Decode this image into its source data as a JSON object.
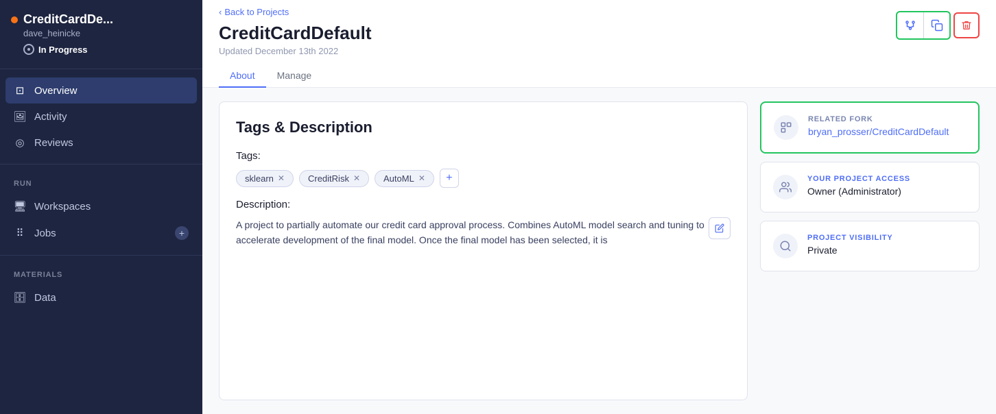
{
  "sidebar": {
    "project_name": "CreditCardDe...",
    "user": "dave_heinicke",
    "status": "In Progress",
    "nav_items": [
      {
        "id": "overview",
        "label": "Overview",
        "active": true
      },
      {
        "id": "activity",
        "label": "Activity",
        "active": false
      },
      {
        "id": "reviews",
        "label": "Reviews",
        "active": false
      }
    ],
    "run_section": "RUN",
    "run_items": [
      {
        "id": "workspaces",
        "label": "Workspaces"
      },
      {
        "id": "jobs",
        "label": "Jobs",
        "badge": "+"
      }
    ],
    "materials_section": "MATERIALS",
    "materials_items": [
      {
        "id": "data",
        "label": "Data"
      }
    ]
  },
  "header": {
    "back_label": "Back to Projects",
    "project_title": "CreditCardDefault",
    "updated_text": "Updated December 13th 2022"
  },
  "tabs": [
    {
      "id": "about",
      "label": "About",
      "active": true
    },
    {
      "id": "manage",
      "label": "Manage",
      "active": false
    }
  ],
  "main_panel": {
    "title": "Tags & Description",
    "tags_label": "Tags:",
    "tags": [
      {
        "label": "sklearn"
      },
      {
        "label": "CreditRisk"
      },
      {
        "label": "AutoML"
      }
    ],
    "description_label": "Description:",
    "description_text": "A project to partially automate our credit card approval process. Combines AutoML model search and tuning to accelerate development of the final model. Once the final model has been selected, it is"
  },
  "right_panel": {
    "related_fork": {
      "label": "RELATED FORK",
      "value": "bryan_prosser/CreditCardDefault",
      "highlighted": true
    },
    "project_access": {
      "label": "YOUR PROJECT ACCESS",
      "value": "Owner (Administrator)"
    },
    "project_visibility": {
      "label": "PROJECT VISIBILITY",
      "value": "Private"
    }
  },
  "toolbar": {
    "fork_icon": "⑂",
    "copy_icon": "⧉",
    "delete_icon": "🗑"
  }
}
